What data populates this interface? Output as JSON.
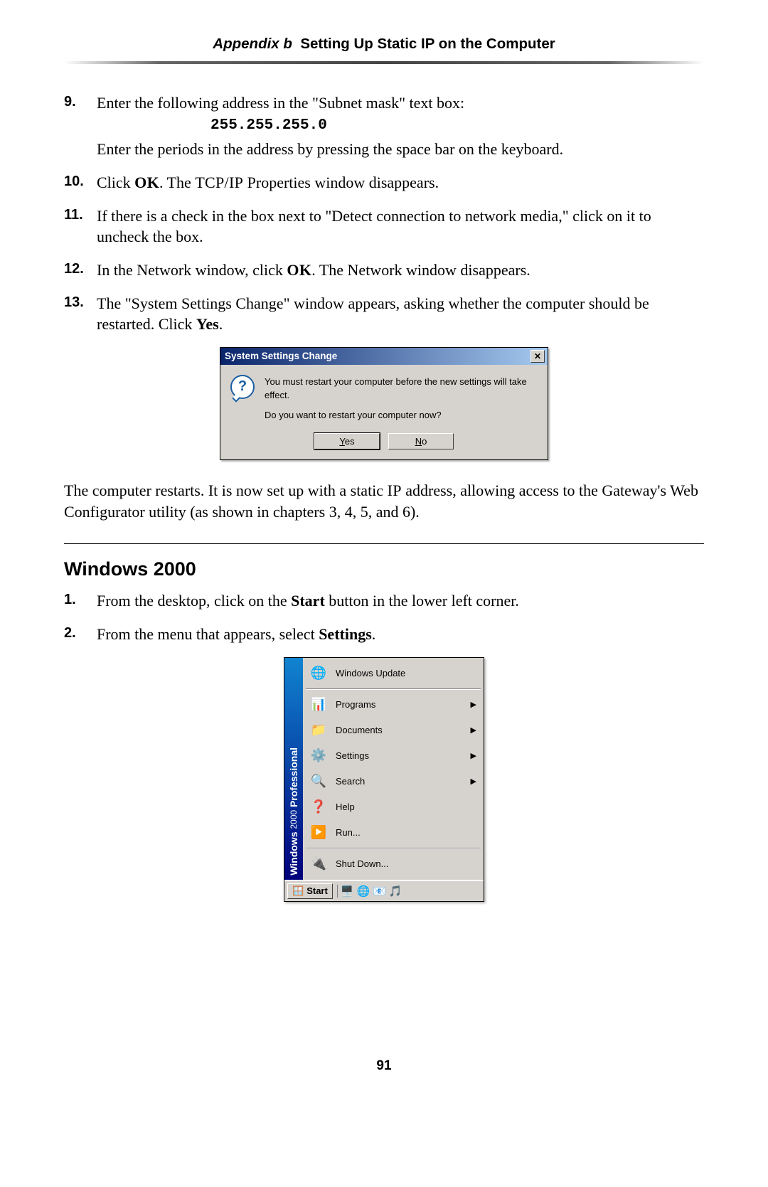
{
  "header": {
    "appendix": "Appendix b",
    "title": "Setting Up Static IP on the Computer"
  },
  "steps": {
    "s9": {
      "num": "9.",
      "lead": "Enter the following address in the \"Subnet mask\" text box:",
      "code": "255.255.255.0",
      "tail": "Enter the periods in the address by pressing the space bar on the keyboard."
    },
    "s10": {
      "num": "10.",
      "pre": "Click ",
      "ok": "OK",
      "post": ". The ",
      "tcpip": "TCP/IP",
      "end": " Properties window disappears."
    },
    "s11": {
      "num": "11.",
      "text": "If there is a check in the box next to \"Detect connection to network media,\" click on it to uncheck the box."
    },
    "s12": {
      "num": "12.",
      "pre": "In the Network window, click ",
      "ok": "OK",
      "post": ". The Network window disappears."
    },
    "s13": {
      "num": "13.",
      "pre": "The \"System Settings Change\" window appears, asking whether the computer should be restarted. Click ",
      "yes": "Yes",
      "post": "."
    }
  },
  "dialog": {
    "title": "System Settings Change",
    "line1": "You must restart your computer before the new settings will take effect.",
    "line2": "Do you want to restart your computer now?",
    "yes_u": "Y",
    "yes_rest": "es",
    "no_u": "N",
    "no_rest": "o"
  },
  "closing_paragraph": "The computer restarts. It is now set up with a static IP address, allowing access to the Gateway's Web Configurator utility (as shown in chapters 3, 4, 5, and 6).",
  "closing_ip": "IP",
  "section2": {
    "heading": "Windows 2000",
    "s1": {
      "num": "1.",
      "pre": "From the desktop, click on the ",
      "b": "Start",
      "post": " button in the lower left corner."
    },
    "s2": {
      "num": "2.",
      "pre": "From the menu that appears, select ",
      "b": "Settings",
      "post": "."
    }
  },
  "startmenu": {
    "stripe_windows": "Windows",
    "stripe_2000": "2000",
    "stripe_prof": "Professional",
    "items": {
      "wu": "Windows Update",
      "programs": "Programs",
      "documents": "Documents",
      "settings": "Settings",
      "search": "Search",
      "help": "Help",
      "run": "Run...",
      "shutdown": "Shut Down..."
    },
    "start": "Start"
  },
  "page_number": "91"
}
